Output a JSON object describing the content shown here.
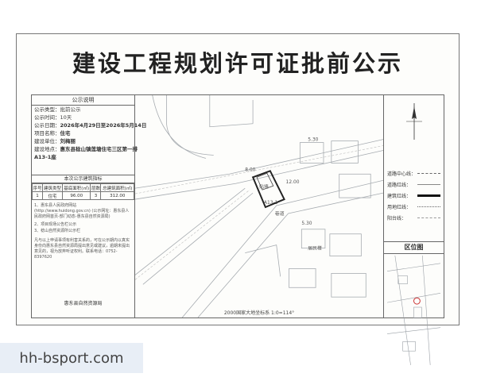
{
  "title": "建设工程规划许可证批前公示",
  "notice": {
    "heading": "公示说明",
    "rows": [
      {
        "key": "公示类型：",
        "value": "批前公示"
      },
      {
        "key": "公示时间：",
        "value": "10天"
      },
      {
        "key": "公示日期：",
        "value": "2026年4月29日至2026年5月14日"
      },
      {
        "key": "项目名称：",
        "value": "住宅"
      },
      {
        "key": "建设单位：",
        "value": "刘梅丽"
      },
      {
        "key": "建设地点：",
        "value": "惠东县稔山镇莲塘住宅三区第一排"
      },
      {
        "key": "",
        "value": "A13-1座"
      }
    ],
    "table": {
      "title": "本次公示建筑指标",
      "headers": [
        "序号",
        "建筑类型",
        "基底面积(㎡)",
        "层数",
        "总建筑面积(㎡)"
      ],
      "rows": [
        [
          "1",
          "住宅",
          "96.00",
          "3",
          "312.00"
        ]
      ]
    },
    "para1": "1、惠东县人民政府网站 (http://www.huidong.gov.cn) (公示网址：惠东县人民政府网首页-部门动态-惠东县自然资源局)",
    "para2": "2、项目现场公告栏公示",
    "para3": "3、稔山自然资源所公示栏",
    "para4": "凡与以上申请事项有利害关系的，可在公示期内以真实身份向惠东县自然资源局提出意见或建议，逾期未提出意见的，视为放弃听证权利。联系电话：0752-8397620",
    "issuer": "惠东县自然资源局"
  },
  "map": {
    "labels": {
      "road_top": "5.30",
      "plot": "A13-1",
      "building": "贴墙",
      "dim1": "8.00",
      "dim2": "12.00",
      "lane": "巷道",
      "neighbor": "居民楼",
      "block": "5.30"
    },
    "scale_label": "2000国家大地坐标系 1:0=114°"
  },
  "legend": {
    "items": [
      {
        "label": "道路中心线：",
        "style": "dashdot"
      },
      {
        "label": "道路红线：",
        "style": "thin"
      },
      {
        "label": "建筑红线：",
        "style": "bold"
      },
      {
        "label": "用地红线：",
        "style": "dotted"
      },
      {
        "label": "阳台线：",
        "style": "dashed"
      }
    ],
    "location_heading": "区位图"
  },
  "watermark": "hh-bsport.com",
  "colors": {
    "ink": "#333333",
    "map_line": "#9aa0a6",
    "building": "#222222"
  }
}
